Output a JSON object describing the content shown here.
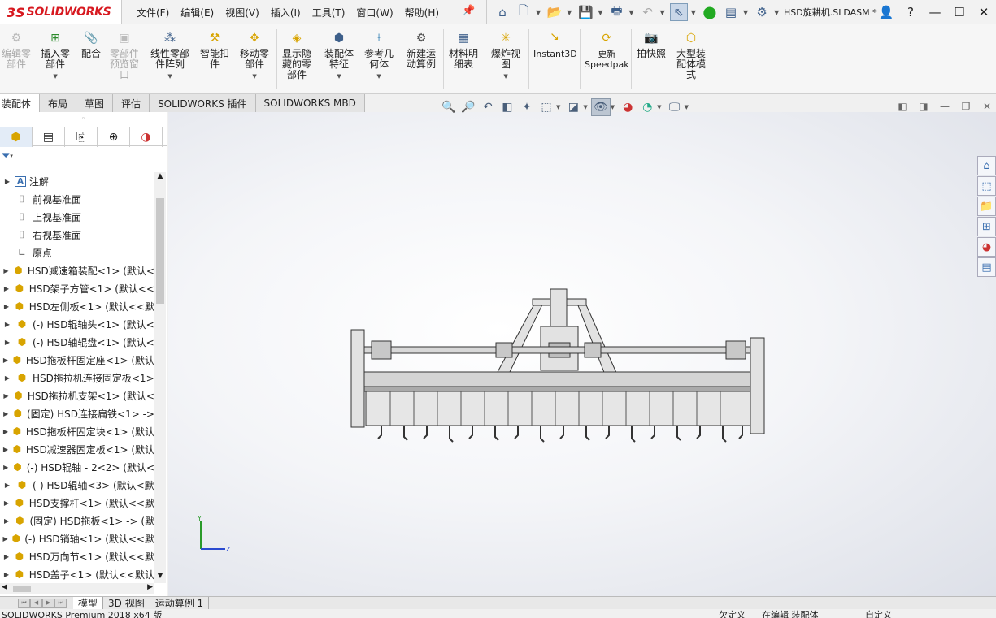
{
  "app": {
    "logo_ds": "3S",
    "logo_text": "SOLIDWORKS",
    "document_title": "HSD旋耕机.SLDASM *"
  },
  "menu": [
    "文件(F)",
    "编辑(E)",
    "视图(V)",
    "插入(I)",
    "工具(T)",
    "窗口(W)",
    "帮助(H)"
  ],
  "commands": [
    {
      "label": "编辑零\n部件",
      "disabled": true
    },
    {
      "label": "插入零\n部件",
      "disabled": false
    },
    {
      "label": "配合",
      "disabled": false
    },
    {
      "label": "零部件\n预览窗\n口",
      "disabled": true
    },
    {
      "label": "线性零部\n件阵列",
      "disabled": false
    },
    {
      "label": "智能扣\n件",
      "disabled": false
    },
    {
      "label": "移动零\n部件",
      "disabled": false
    },
    {
      "label": "显示隐\n藏的零\n部件",
      "disabled": false
    },
    {
      "label": "装配体\n特征",
      "disabled": false
    },
    {
      "label": "参考几\n何体",
      "disabled": false
    },
    {
      "label": "新建运\n动算例",
      "disabled": false
    },
    {
      "label": "材料明\n细表",
      "disabled": false
    },
    {
      "label": "爆炸视\n图",
      "disabled": false
    },
    {
      "label": "Instant3D",
      "disabled": false
    },
    {
      "label": "更新\nSpeedpak",
      "disabled": false
    },
    {
      "label": "拍快照",
      "disabled": false
    },
    {
      "label": "大型装\n配体模\n式",
      "disabled": false
    }
  ],
  "tabs": [
    "装配体",
    "布局",
    "草图",
    "评估",
    "SOLIDWORKS 插件",
    "SOLIDWORKS MBD"
  ],
  "tree": [
    {
      "label": "注解",
      "icon": "note"
    },
    {
      "label": "前视基准面",
      "icon": "plane"
    },
    {
      "label": "上视基准面",
      "icon": "plane"
    },
    {
      "label": "右视基准面",
      "icon": "plane"
    },
    {
      "label": "原点",
      "icon": "origin"
    },
    {
      "label": "HSD减速箱装配<1> (默认<",
      "icon": "asm"
    },
    {
      "label": "HSD架子方管<1> (默认<<",
      "icon": "part"
    },
    {
      "label": "HSD左侧板<1> (默认<<默",
      "icon": "part"
    },
    {
      "label": "(-) HSD辊轴头<1> (默认<",
      "icon": "part"
    },
    {
      "label": "(-) HSD轴辊盘<1> (默认<",
      "icon": "part"
    },
    {
      "label": "HSD拖板杆固定座<1> (默认",
      "icon": "part"
    },
    {
      "label": "HSD拖拉机连接固定板<1>",
      "icon": "part"
    },
    {
      "label": "HSD拖拉机支架<1> (默认<",
      "icon": "part"
    },
    {
      "label": "(固定) HSD连接扁铁<1> ->",
      "icon": "part"
    },
    {
      "label": "HSD拖板杆固定块<1> (默认",
      "icon": "part"
    },
    {
      "label": "HSD减速器固定板<1> (默认",
      "icon": "part"
    },
    {
      "label": "(-) HSD辊轴 - 2<2> (默认<",
      "icon": "part"
    },
    {
      "label": "(-) HSD辊轴<3> (默认<默",
      "icon": "part"
    },
    {
      "label": "HSD支撑杆<1> (默认<<默",
      "icon": "part"
    },
    {
      "label": "(固定) HSD拖板<1> -> (默",
      "icon": "part"
    },
    {
      "label": "(-) HSD销轴<1> (默认<<默",
      "icon": "part"
    },
    {
      "label": "HSD万向节<1> (默认<<默",
      "icon": "part"
    },
    {
      "label": "HSD盖子<1> (默认<<默认",
      "icon": "part"
    }
  ],
  "bottom_tabs": [
    "模型",
    "3D 视图",
    "运动算例 1"
  ],
  "status": {
    "left": "SOLIDWORKS Premium 2018 x64 版",
    "s1": "欠定义",
    "s2": "在编辑 装配体",
    "s3": "自定义"
  },
  "triad": {
    "y": "Y",
    "z": "Z"
  }
}
